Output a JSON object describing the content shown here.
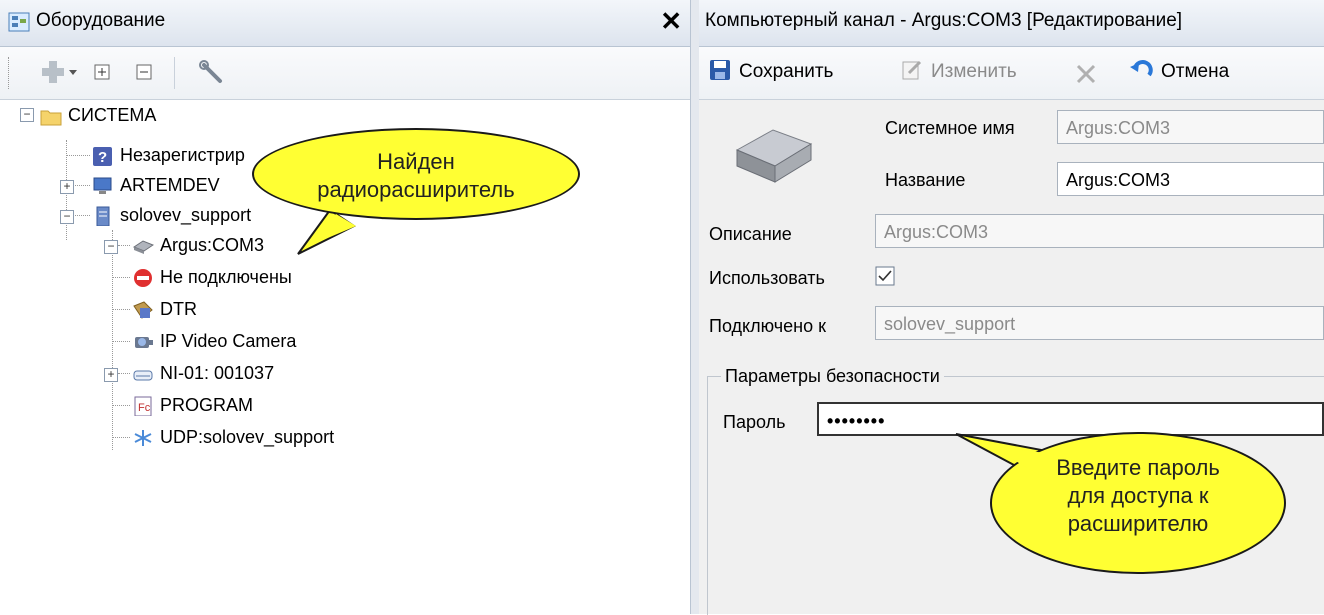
{
  "left_panel": {
    "title": "Оборудование",
    "close_glyph": "✕"
  },
  "tree": {
    "root": {
      "label": "СИСТЕМА",
      "icon": "folder-icon"
    },
    "items": [
      {
        "label": "Незарегистрир",
        "icon": "help-icon"
      },
      {
        "label": "ARTEMDEV",
        "icon": "computer-icon"
      },
      {
        "label": "solovev_support",
        "icon": "server-icon"
      },
      {
        "label": "Argus:COM3",
        "icon": "device-icon"
      },
      {
        "label": "Не подключены",
        "icon": "stop-icon"
      },
      {
        "label": "DTR",
        "icon": "dtr-icon"
      },
      {
        "label": "IP Video Camera",
        "icon": "camera-icon"
      },
      {
        "label": "NI-01: 001037",
        "icon": "drive-icon"
      },
      {
        "label": "PROGRAM",
        "icon": "program-icon"
      },
      {
        "label": "UDP:solovev_support",
        "icon": "network-icon"
      }
    ]
  },
  "right_panel": {
    "title": "Компьютерный канал - Argus:COM3 [Редактирование]",
    "toolbar": {
      "save": "Сохранить",
      "edit": "Изменить",
      "cancel": "Отмена"
    },
    "form": {
      "system_name_label": "Системное имя",
      "system_name_value": "Argus:COM3",
      "name_label": "Название",
      "name_value": "Argus:COM3",
      "description_label": "Описание",
      "description_value": "Argus:COM3",
      "use_label": "Использовать",
      "use_checked": true,
      "connected_label": "Подключено к",
      "connected_value": "solovev_support",
      "security_group": "Параметры безопасности",
      "password_label": "Пароль",
      "password_value": "••••••••"
    }
  },
  "callouts": {
    "found": [
      "Найден",
      "радиорасширитель"
    ],
    "password_hint": [
      "Введите пароль",
      "для доступа к",
      "расширителю"
    ]
  },
  "colors": {
    "callout": "#ffff33",
    "title_bar": "#dde4ee"
  }
}
